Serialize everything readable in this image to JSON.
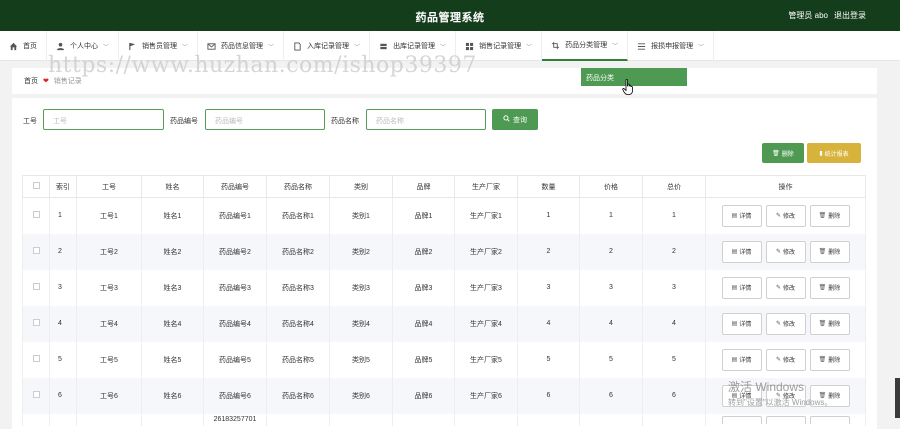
{
  "header": {
    "title": "药品管理系统",
    "user": "管理员 abo",
    "logout": "退出登录"
  },
  "nav": [
    {
      "label": "首页",
      "icon": "home-icon",
      "chevron": false
    },
    {
      "label": "个人中心",
      "icon": "person-icon",
      "chevron": true
    },
    {
      "label": "销售员管理",
      "icon": "flag-icon",
      "chevron": true
    },
    {
      "label": "药品信息管理",
      "icon": "mail-icon",
      "chevron": true
    },
    {
      "label": "入库记录管理",
      "icon": "document-icon",
      "chevron": true
    },
    {
      "label": "出库记录管理",
      "icon": "stack-icon",
      "chevron": true
    },
    {
      "label": "销售记录管理",
      "icon": "grid-icon",
      "chevron": true
    },
    {
      "label": "药品分类管理",
      "icon": "crop-icon",
      "chevron": true
    },
    {
      "label": "报损申报管理",
      "icon": "list-icon",
      "chevron": true
    }
  ],
  "dropdown": {
    "item": "药品分类"
  },
  "watermark": "https://www.huzhan.com/ishop39397",
  "breadcrumb": {
    "home": "首页",
    "current": "销售记录"
  },
  "search": {
    "f1_label": "工号",
    "f1_placeholder": "工号",
    "f2_label": "药品编号",
    "f2_placeholder": "药品编号",
    "f3_label": "药品名称",
    "f3_placeholder": "药品名称",
    "button": "查询"
  },
  "actions": {
    "delete": "删除",
    "stats": "统计报表"
  },
  "table": {
    "headers": [
      "",
      "索引",
      "工号",
      "姓名",
      "药品编号",
      "药品名称",
      "类别",
      "品牌",
      "生产厂家",
      "数量",
      "价格",
      "总价",
      "操作"
    ],
    "rows": [
      [
        "1",
        "工号1",
        "姓名1",
        "药品编号1",
        "药品名称1",
        "类别1",
        "品牌1",
        "生产厂家1",
        "1",
        "1",
        "1"
      ],
      [
        "2",
        "工号2",
        "姓名2",
        "药品编号2",
        "药品名称2",
        "类别2",
        "品牌2",
        "生产厂家2",
        "2",
        "2",
        "2"
      ],
      [
        "3",
        "工号3",
        "姓名3",
        "药品编号3",
        "药品名称3",
        "类别3",
        "品牌3",
        "生产厂家3",
        "3",
        "3",
        "3"
      ],
      [
        "4",
        "工号4",
        "姓名4",
        "药品编号4",
        "药品名称4",
        "类别4",
        "品牌4",
        "生产厂家4",
        "4",
        "4",
        "4"
      ],
      [
        "5",
        "工号5",
        "姓名5",
        "药品编号5",
        "药品名称5",
        "类别5",
        "品牌5",
        "生产厂家5",
        "5",
        "5",
        "5"
      ],
      [
        "6",
        "工号6",
        "姓名6",
        "药品编号6",
        "药品名称6",
        "类别6",
        "品牌6",
        "生产厂家6",
        "6",
        "6",
        "6"
      ]
    ],
    "partial_row_code": "26183257701",
    "ops": {
      "detail": "详情",
      "edit": "修改",
      "delete": "删除"
    }
  },
  "windows_watermark": {
    "line1": "激活 Windows",
    "line2": "转到\"设置\"以激活 Windows。"
  },
  "colors": {
    "header_bg": "#143d1c",
    "primary": "#4e9a53",
    "warning": "#d8b33c"
  }
}
